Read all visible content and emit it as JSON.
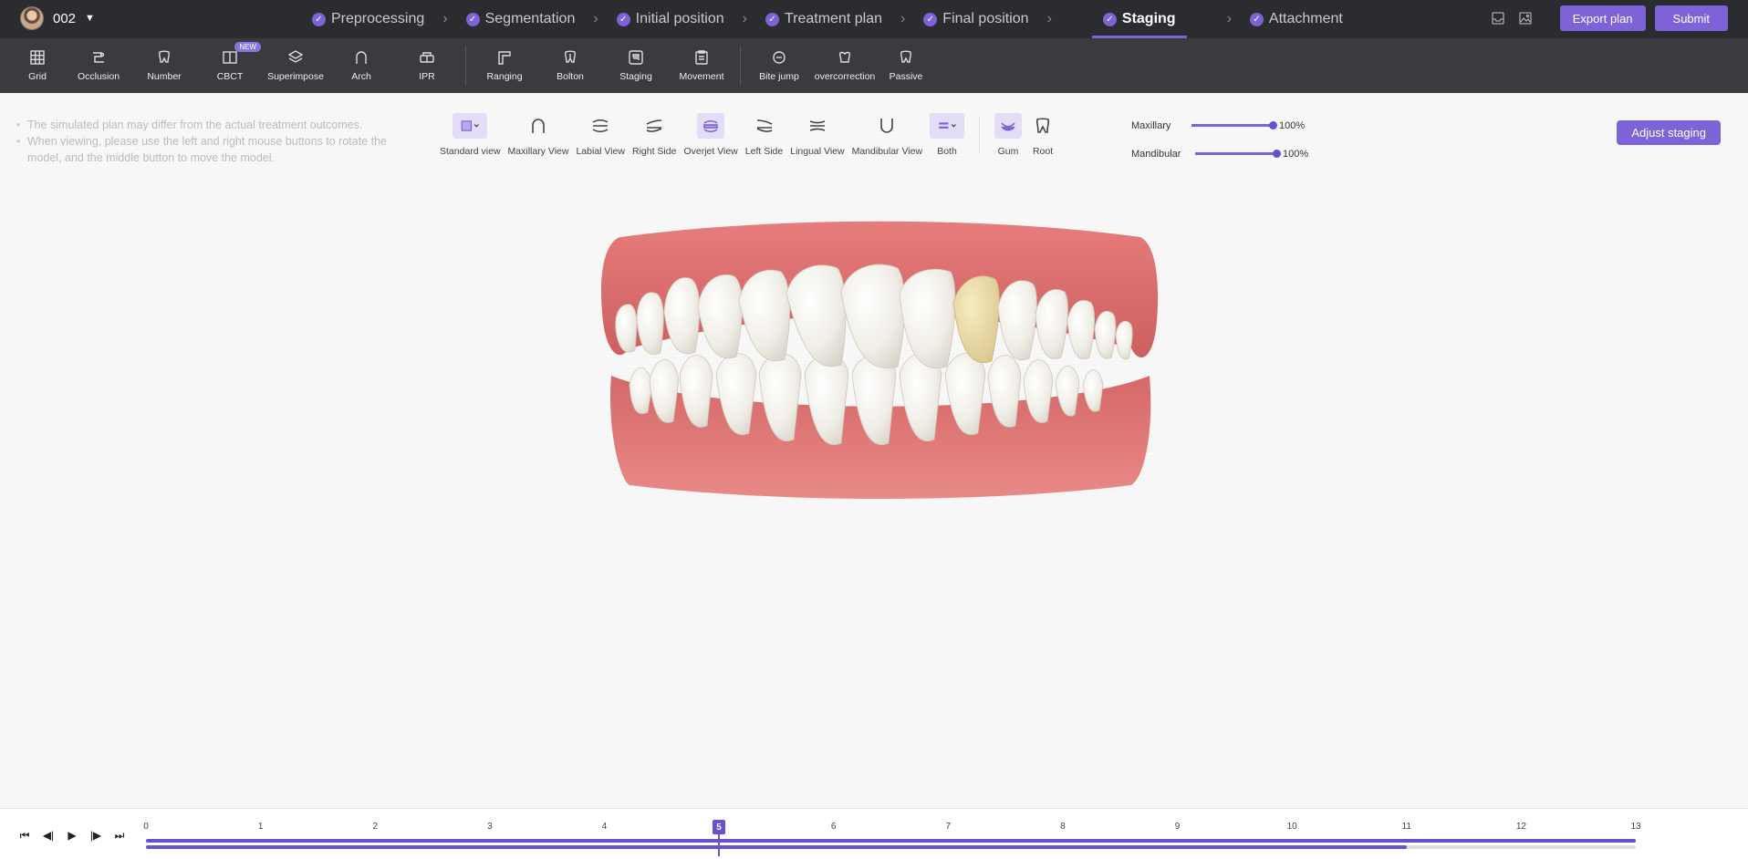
{
  "patient": {
    "name": "002"
  },
  "steps": [
    {
      "label": "Preprocessing",
      "active": false
    },
    {
      "label": "Segmentation",
      "active": false
    },
    {
      "label": "Initial position",
      "active": false
    },
    {
      "label": "Treatment plan",
      "active": false
    },
    {
      "label": "Final position",
      "active": false
    },
    {
      "label": "Staging",
      "active": true
    },
    {
      "label": "Attachment",
      "active": false
    }
  ],
  "header": {
    "export_label": "Export plan",
    "submit_label": "Submit"
  },
  "toolbar": {
    "grid": "Grid",
    "occlusion": "Occlusion",
    "number": "Number",
    "cbct": "CBCT",
    "new_badge": "NEW",
    "superimpose": "Superimpose",
    "arch": "Arch",
    "ipr": "IPR",
    "ranging": "Ranging",
    "bolton": "Bolton",
    "staging": "Staging",
    "movement": "Movement",
    "bite_jump": "Bite jump",
    "overcorrection": "overcorrection",
    "passive": "Passive"
  },
  "notes": [
    "The simulated plan may differ from the actual treatment outcomes.",
    "When viewing, please use the left and right mouse buttons to rotate the model, and the middle button to move the model."
  ],
  "views": {
    "standard": "Standard view",
    "maxillary": "Maxillary View",
    "labial": "Labial View",
    "right_side": "Right Side",
    "overjet": "Overjet View",
    "left_side": "Left Side",
    "lingual": "Lingual View",
    "mandibular": "Mandibular View",
    "both": "Both",
    "gum": "Gum",
    "root": "Root"
  },
  "opacity": {
    "maxillary_label": "Maxillary",
    "maxillary_value": "100%",
    "mandibular_label": "Mandibular",
    "mandibular_value": "100%"
  },
  "adjust_label": "Adjust staging",
  "timeline": {
    "ticks": [
      "0",
      "1",
      "2",
      "3",
      "4",
      "5",
      "6",
      "7",
      "8",
      "9",
      "10",
      "11",
      "12",
      "13"
    ],
    "current": "5",
    "current_index": 5,
    "max_index": 13,
    "lower_progress_index": 11
  }
}
